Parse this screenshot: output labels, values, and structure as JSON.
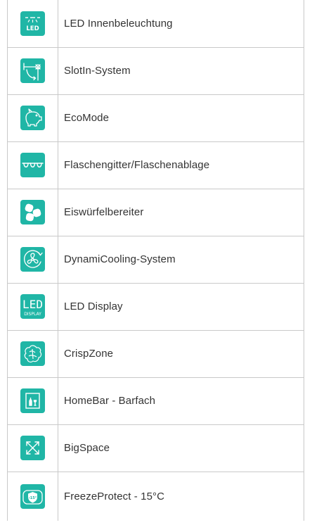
{
  "accent_color": "#20b6a6",
  "features": [
    {
      "icon": "led-lighting-icon",
      "label": "LED Innenbeleuchtung",
      "icon_text": "LED"
    },
    {
      "icon": "slotin-system-icon",
      "label": "SlotIn-System"
    },
    {
      "icon": "piggy-bank-icon",
      "label": "EcoMode"
    },
    {
      "icon": "bottle-rack-icon",
      "label": "Flaschengitter/Flaschenablage"
    },
    {
      "icon": "ice-cubes-icon",
      "label": "Eiswürfelbereiter"
    },
    {
      "icon": "fan-icon",
      "label": "DynamiCooling-System"
    },
    {
      "icon": "led-display-icon",
      "label": "LED Display",
      "icon_text": "LED",
      "icon_subtext": "DISPLAY"
    },
    {
      "icon": "lettuce-icon",
      "label": "CrispZone"
    },
    {
      "icon": "bottle-bar-icon",
      "label": "HomeBar - Barfach"
    },
    {
      "icon": "expand-arrows-icon",
      "label": "BigSpace"
    },
    {
      "icon": "shield-icon",
      "label": "FreezeProtect - 15°C",
      "icon_text": "-15°"
    }
  ]
}
